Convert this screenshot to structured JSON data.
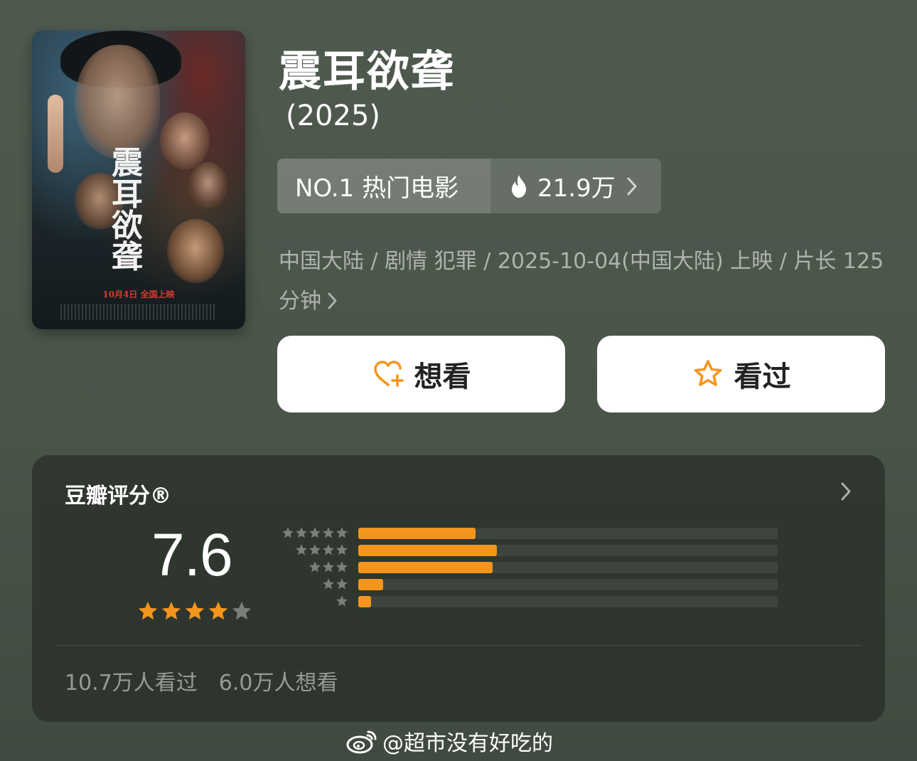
{
  "movie": {
    "title": "震耳欲聋",
    "year": "(2025)",
    "poster": {
      "title_art": "震耳欲聋",
      "release_text": "10月4日 全国上映"
    }
  },
  "rank": {
    "label": "NO.1 热门电影",
    "heat": "21.9万"
  },
  "meta": {
    "line": "中国大陆 / 剧情 犯罪 / 2025-10-04(中国大陆) 上映 / 片长 125 分钟"
  },
  "actions": {
    "want_label": "想看",
    "seen_label": "看过",
    "icon_color": "#f5951b"
  },
  "rating": {
    "title": "豆瓣评分®",
    "score": "7.6",
    "stars_filled": 4,
    "stars_total": 5,
    "distribution": [
      {
        "stars": 5,
        "fraction": 0.28
      },
      {
        "stars": 4,
        "fraction": 0.33
      },
      {
        "stars": 3,
        "fraction": 0.32
      },
      {
        "stars": 2,
        "fraction": 0.06
      },
      {
        "stars": 1,
        "fraction": 0.03
      }
    ],
    "seen_count": "10.7万人看过",
    "want_count": "6.0万人想看"
  },
  "watermark": {
    "text": "@超市没有好吃的"
  },
  "colors": {
    "accent": "#f5951b",
    "star_empty": "#7a7f7a",
    "background": "#4f5a4f"
  }
}
